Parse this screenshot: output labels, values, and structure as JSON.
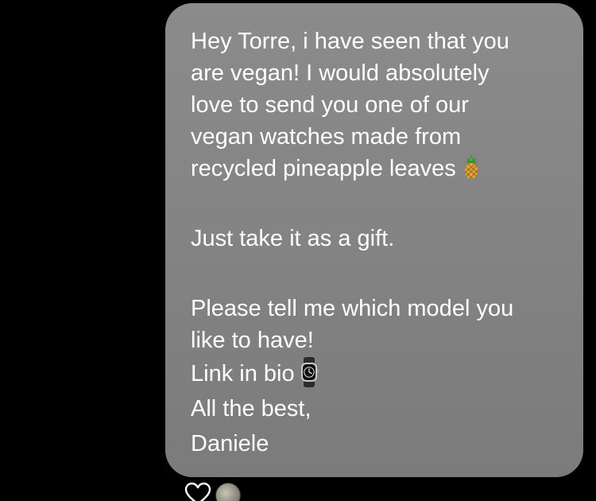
{
  "message": {
    "paragraph1": {
      "line1": "Hey Torre, i have seen that you",
      "line2": "are vegan! I would absolutely",
      "line3": "love to send you one of our",
      "line4": "vegan watches made from",
      "line5": "recycled pineapple leaves",
      "line5_emoji": "pineapple-icon"
    },
    "paragraph2": {
      "line1": "Just take it as a gift."
    },
    "paragraph3": {
      "line1": "Please tell me which model you",
      "line2": "like to have!",
      "line3": "Link in bio",
      "line3_emoji": "watch-icon",
      "line4": "All the best,",
      "line5": "Daniele"
    },
    "bubble_color": "#858585",
    "text_color": "#ffffff"
  },
  "reactions": {
    "like_icon": "heart-outline-icon",
    "avatar_icon": "seen-avatar-icon"
  },
  "colors": {
    "background": "#000000"
  }
}
